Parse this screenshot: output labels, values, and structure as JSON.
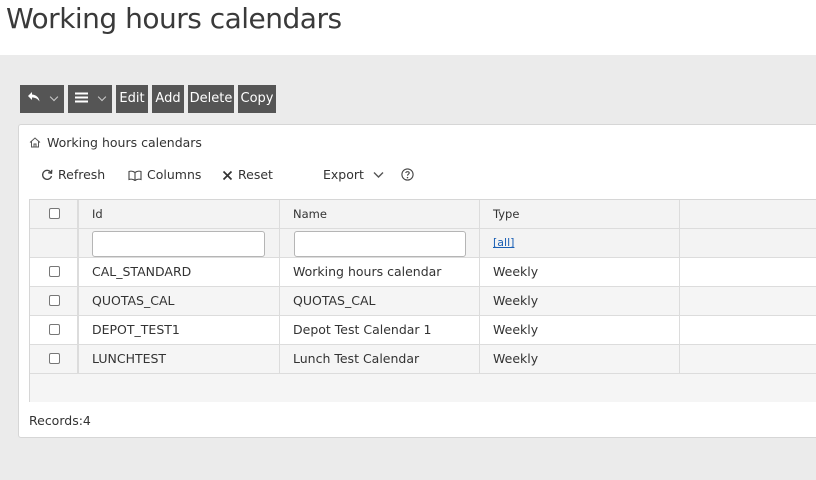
{
  "page": {
    "title": "Working hours calendars"
  },
  "toolbar": {
    "back_icon": "reply-arrow-icon",
    "menu_icon": "hamburger-menu-icon",
    "edit_label": "Edit",
    "add_label": "Add",
    "delete_label": "Delete",
    "copy_label": "Copy"
  },
  "panel": {
    "breadcrumb": "Working hours calendars",
    "actions": {
      "refresh": "Refresh",
      "columns": "Columns",
      "reset": "Reset",
      "export": "Export"
    }
  },
  "grid": {
    "columns": [
      "Id",
      "Name",
      "Type"
    ],
    "filters": {
      "id": "",
      "name": "",
      "type_link": "[all]"
    },
    "rows": [
      {
        "id": "CAL_STANDARD",
        "name": "Working hours calendar",
        "type": "Weekly"
      },
      {
        "id": "QUOTAS_CAL",
        "name": "QUOTAS_CAL",
        "type": "Weekly"
      },
      {
        "id": "DEPOT_TEST1",
        "name": "Depot Test Calendar 1",
        "type": "Weekly"
      },
      {
        "id": "LUNCHTEST",
        "name": "Lunch Test Calendar",
        "type": "Weekly"
      }
    ]
  },
  "footer": {
    "records": "Records:4"
  }
}
